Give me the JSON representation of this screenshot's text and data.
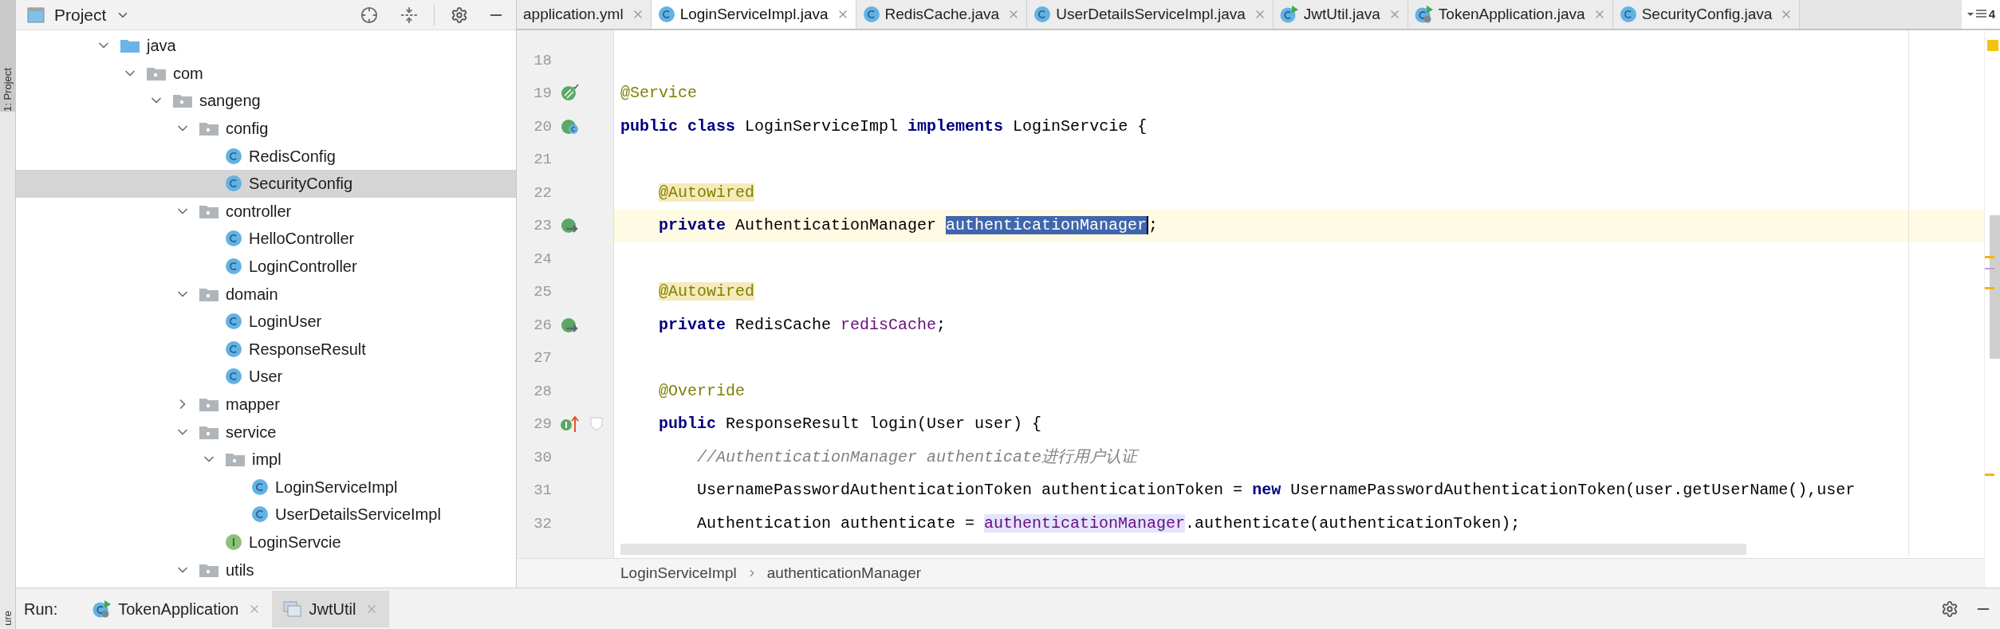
{
  "side_strip": {
    "top_label": "1: Project",
    "bottom_label": "ure"
  },
  "project_panel": {
    "title": "Project",
    "tree": [
      {
        "label": "java",
        "kind": "source-root",
        "expanded": true,
        "selected": false,
        "children": [
          {
            "label": "com",
            "kind": "package",
            "expanded": true,
            "selected": false,
            "children": [
              {
                "label": "sangeng",
                "kind": "package",
                "expanded": true,
                "selected": false,
                "children": [
                  {
                    "label": "config",
                    "kind": "package",
                    "expanded": true,
                    "selected": false,
                    "children": [
                      {
                        "label": "RedisConfig",
                        "kind": "class",
                        "selected": false
                      },
                      {
                        "label": "SecurityConfig",
                        "kind": "class",
                        "selected": true
                      }
                    ]
                  },
                  {
                    "label": "controller",
                    "kind": "package",
                    "expanded": true,
                    "selected": false,
                    "children": [
                      {
                        "label": "HelloController",
                        "kind": "class",
                        "selected": false
                      },
                      {
                        "label": "LoginController",
                        "kind": "class",
                        "selected": false
                      }
                    ]
                  },
                  {
                    "label": "domain",
                    "kind": "package",
                    "expanded": true,
                    "selected": false,
                    "children": [
                      {
                        "label": "LoginUser",
                        "kind": "class",
                        "selected": false
                      },
                      {
                        "label": "ResponseResult",
                        "kind": "class",
                        "selected": false
                      },
                      {
                        "label": "User",
                        "kind": "class",
                        "selected": false
                      }
                    ]
                  },
                  {
                    "label": "mapper",
                    "kind": "package",
                    "expanded": false,
                    "selected": false
                  },
                  {
                    "label": "service",
                    "kind": "package",
                    "expanded": true,
                    "selected": false,
                    "children": [
                      {
                        "label": "impl",
                        "kind": "package",
                        "expanded": true,
                        "selected": false,
                        "children": [
                          {
                            "label": "LoginServiceImpl",
                            "kind": "class",
                            "selected": false
                          },
                          {
                            "label": "UserDetailsServiceImpl",
                            "kind": "class",
                            "selected": false
                          }
                        ]
                      },
                      {
                        "label": "LoginServcie",
                        "kind": "interface",
                        "selected": false
                      }
                    ]
                  },
                  {
                    "label": "utils",
                    "kind": "package",
                    "expanded": true,
                    "selected": false
                  }
                ]
              }
            ]
          }
        ]
      }
    ]
  },
  "editor": {
    "tabs": [
      {
        "label": "application.yml",
        "kind": "yaml",
        "selected": false
      },
      {
        "label": "LoginServiceImpl.java",
        "kind": "class",
        "selected": true
      },
      {
        "label": "RedisCache.java",
        "kind": "class",
        "selected": false
      },
      {
        "label": "UserDetailsServiceImpl.java",
        "kind": "class",
        "selected": false
      },
      {
        "label": "JwtUtil.java",
        "kind": "class-run",
        "selected": false
      },
      {
        "label": "TokenApplication.java",
        "kind": "app-run",
        "selected": false
      },
      {
        "label": "SecurityConfig.java",
        "kind": "class",
        "selected": false
      }
    ],
    "overflow_count": "4",
    "lines": [
      {
        "number": "18",
        "fold": false,
        "current": false
      },
      {
        "number": "19",
        "marker": {
          "kind": "bean"
        },
        "fold": false,
        "current": false,
        "kind": "top",
        "tokens": [
          {
            "text": "@Service",
            "kind": "annotation"
          }
        ]
      },
      {
        "number": "20",
        "marker": {
          "kind": "bean-class"
        },
        "fold": false,
        "current": false,
        "kind": "top",
        "tokens": [
          {
            "text": "public class",
            "kind": "keyword"
          },
          {
            "text": " LoginServiceImpl ",
            "kind": "plain"
          },
          {
            "text": "implements",
            "kind": "keyword"
          },
          {
            "text": " LoginServcie {",
            "kind": "plain"
          }
        ]
      },
      {
        "number": "21",
        "fold": false,
        "current": false
      },
      {
        "number": "22",
        "fold": false,
        "current": false,
        "kind": "member",
        "tokens": [
          {
            "text": "@Autowired",
            "kind": "annotation-marked"
          }
        ]
      },
      {
        "number": "23",
        "marker": {
          "kind": "autowired"
        },
        "fold": false,
        "current": true,
        "kind": "member",
        "tokens": [
          {
            "text": "private",
            "kind": "keyword"
          },
          {
            "text": " AuthenticationManager ",
            "kind": "plain"
          },
          {
            "text": "authenticationManager",
            "kind": "selection"
          },
          {
            "text": ";",
            "kind": "plain"
          }
        ]
      },
      {
        "number": "24",
        "fold": false,
        "current": false
      },
      {
        "number": "25",
        "fold": false,
        "current": false,
        "kind": "member",
        "tokens": [
          {
            "text": "@Autowired",
            "kind": "annotation-marked"
          }
        ]
      },
      {
        "number": "26",
        "marker": {
          "kind": "autowired"
        },
        "fold": false,
        "current": false,
        "kind": "member",
        "tokens": [
          {
            "text": "private",
            "kind": "keyword"
          },
          {
            "text": " RedisCache ",
            "kind": "plain"
          },
          {
            "text": "redisCache",
            "kind": "field"
          },
          {
            "text": ";",
            "kind": "plain"
          }
        ]
      },
      {
        "number": "27",
        "fold": false,
        "current": false
      },
      {
        "number": "28",
        "fold": false,
        "current": false,
        "kind": "member",
        "tokens": [
          {
            "text": "@Override",
            "kind": "annotation"
          }
        ]
      },
      {
        "number": "29",
        "marker": {
          "kind": "implements"
        },
        "fold": true,
        "current": false,
        "kind": "member",
        "tokens": [
          {
            "text": "public",
            "kind": "keyword"
          },
          {
            "text": " ResponseResult login(User user) {",
            "kind": "plain"
          }
        ]
      },
      {
        "number": "30",
        "fold": false,
        "current": false,
        "kind": "body",
        "tokens": [
          {
            "text": "//AuthenticationManager authenticate进行用户认证",
            "kind": "comment"
          }
        ]
      },
      {
        "number": "31",
        "fold": false,
        "current": false,
        "kind": "body",
        "tokens": [
          {
            "text": "UsernamePasswordAuthenticationToken authenticationToken = ",
            "kind": "plain"
          },
          {
            "text": "new",
            "kind": "keyword"
          },
          {
            "text": " UsernamePasswordAuthenticationToken(user.getUserName(),user",
            "kind": "plain"
          }
        ]
      },
      {
        "number": "32",
        "fold": false,
        "current": false,
        "kind": "body",
        "tokens": [
          {
            "text": "Authentication authenticate = ",
            "kind": "plain"
          },
          {
            "text": "authenticationManager",
            "kind": "usage"
          },
          {
            "text": ".authenticate(authenticationToken);",
            "kind": "plain"
          }
        ]
      }
    ],
    "breadcrumb": [
      "LoginServiceImpl",
      "authenticationManager"
    ]
  },
  "run_bar": {
    "label": "Run:",
    "tabs": [
      {
        "label": "TokenApplication",
        "kind": "app-run",
        "selected": false
      },
      {
        "label": "JwtUtil",
        "kind": "window",
        "selected": true
      }
    ]
  }
}
